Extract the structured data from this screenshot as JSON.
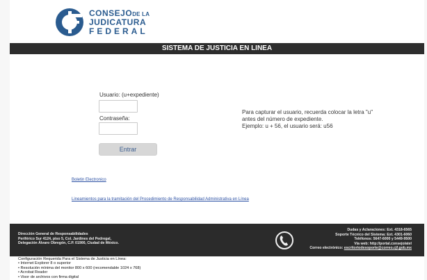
{
  "header": {
    "org_line1_main": "CONSEJO",
    "org_line1_small": "DE LA",
    "org_line2": "JUDICATURA",
    "org_line3": "FEDERAL",
    "logo_icon": "cjf-logo",
    "colors": {
      "brand_blue": "#2a5b8f"
    }
  },
  "titlebar": {
    "title": "SISTEMA DE JUSTICIA EN LINEA"
  },
  "form": {
    "user_label": "Usuario: (u+expediente)",
    "password_label": "Contraseña:",
    "user_value": "",
    "password_value": "",
    "submit_label": "Entrar"
  },
  "help": {
    "text": "Para capturar el usuario, recuerda colocar la letra \"u\" antes del número de expediente.",
    "example": "Ejemplo: u + 56, el usuario será: u56"
  },
  "links": {
    "boletin": "Boletin Electronico",
    "lineamientos": "Lineamientos para la tramitación del Procedimiento de Responsabilidad Administrativa en Línea"
  },
  "footer": {
    "left_lines": [
      "Dirección General de Responsabilidades",
      "Periférico Sur 4124, piso 5, Col. Jardines del Pedregal,",
      "Delegación Álvaro Obregón, C.P. 01900, Ciudad de México."
    ],
    "right_lines": [
      "Dudas y Aclaraciones: Ext. 4318-6565",
      "Soporte Técnico del Sistema: Ext. 4301-6060",
      "Teléfonos: 5647-6000 y 5449-9500",
      "Vía web: http://portal.consejo/atel"
    ],
    "email_label": "Correo electrónico:",
    "email_value": "escritoriodesoporte@correo.cjf.gob.mx",
    "phone_icon": "phone-icon"
  },
  "config": {
    "title": "Configuración Requerida Para el Sistema de Justicia en Línea:",
    "items": [
      "• Internet Explorer 8 o superior",
      "• Resolución mínima del monitor 800 x 600 (recomendable 1024 x 768)",
      "• Acrobat Reader",
      "• Visor de archivos con firma digital"
    ]
  }
}
